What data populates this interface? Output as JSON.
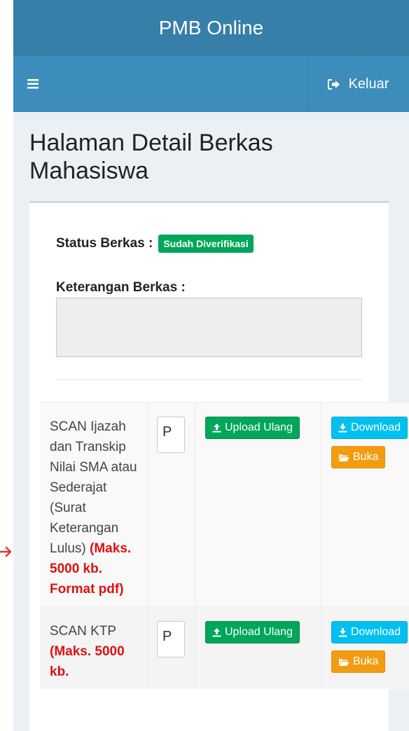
{
  "app": {
    "title": "PMB Online"
  },
  "nav": {
    "logout_label": "Keluar"
  },
  "page": {
    "title": "Halaman Detail Berkas Mahasiswa"
  },
  "status": {
    "label": "Status Berkas :",
    "badge": "Sudah Diverifikasi"
  },
  "keterangan": {
    "label": "Keterangan Berkas :",
    "value": ""
  },
  "rows": [
    {
      "desc": "SCAN Ijazah dan Transkip Nilai SMA atau Sederajat (Surat Keterangan Lulus)",
      "note": "(Maks. 5000 kb. Format pdf)",
      "file_label": "P",
      "upload_label": "Upload Ulang",
      "download_label": "Download",
      "open_label": "Buka"
    },
    {
      "desc": "SCAN KTP",
      "note": "(Maks. 5000 kb.",
      "file_label": "P",
      "upload_label": "Upload Ulang",
      "download_label": "Download",
      "open_label": "Buka"
    }
  ],
  "colors": {
    "header_dark": "#367fa9",
    "header": "#3c8dbc",
    "success": "#00a65a",
    "info": "#00c0ef",
    "warning": "#f39c12",
    "danger": "#dd1111"
  }
}
